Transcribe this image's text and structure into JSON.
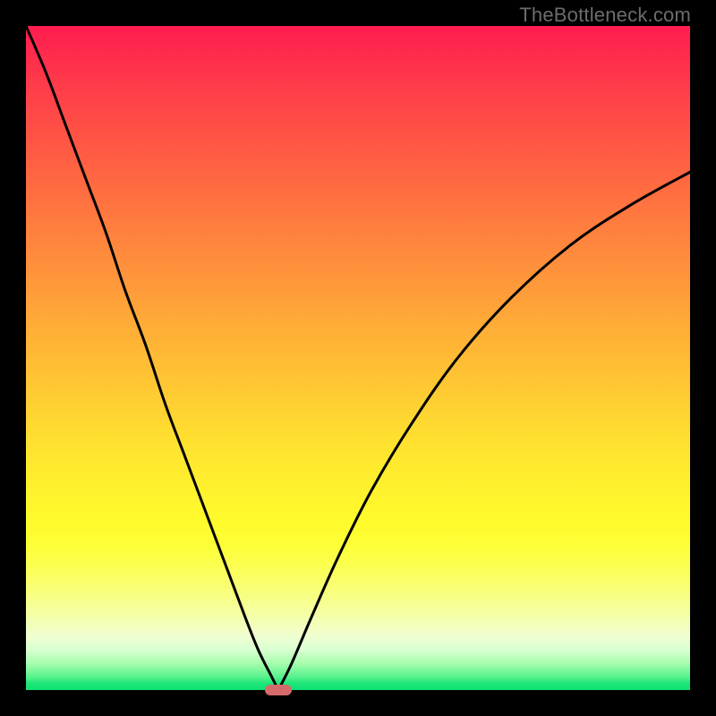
{
  "watermark": "TheBottleneck.com",
  "colors": {
    "page_bg": "#000000",
    "curve": "#000000",
    "marker": "#d56a6b",
    "gradient_top": "#ff1c4f",
    "gradient_bottom": "#0ee173"
  },
  "chart_data": {
    "type": "line",
    "title": "",
    "xlabel": "",
    "ylabel": "",
    "xlim": [
      0,
      100
    ],
    "ylim": [
      0,
      100
    ],
    "grid": false,
    "legend": false,
    "annotations": [
      {
        "text": "TheBottleneck.com",
        "position": "top-right"
      }
    ],
    "series": [
      {
        "name": "left-branch",
        "x": [
          0,
          3,
          6,
          9,
          12,
          15,
          18,
          21,
          24,
          27,
          30,
          33,
          35,
          37,
          38
        ],
        "values": [
          100,
          93,
          85,
          77,
          69,
          60,
          52,
          43,
          35,
          27,
          19,
          11,
          6,
          2,
          0
        ]
      },
      {
        "name": "right-branch",
        "x": [
          38,
          40,
          43,
          47,
          52,
          58,
          65,
          73,
          82,
          91,
          100
        ],
        "values": [
          0,
          4,
          11,
          20,
          30,
          40,
          50,
          59,
          67,
          73,
          78
        ]
      }
    ],
    "marker": {
      "x": 38,
      "y": 0,
      "width_pct": 4,
      "height_pct": 1.6
    }
  }
}
